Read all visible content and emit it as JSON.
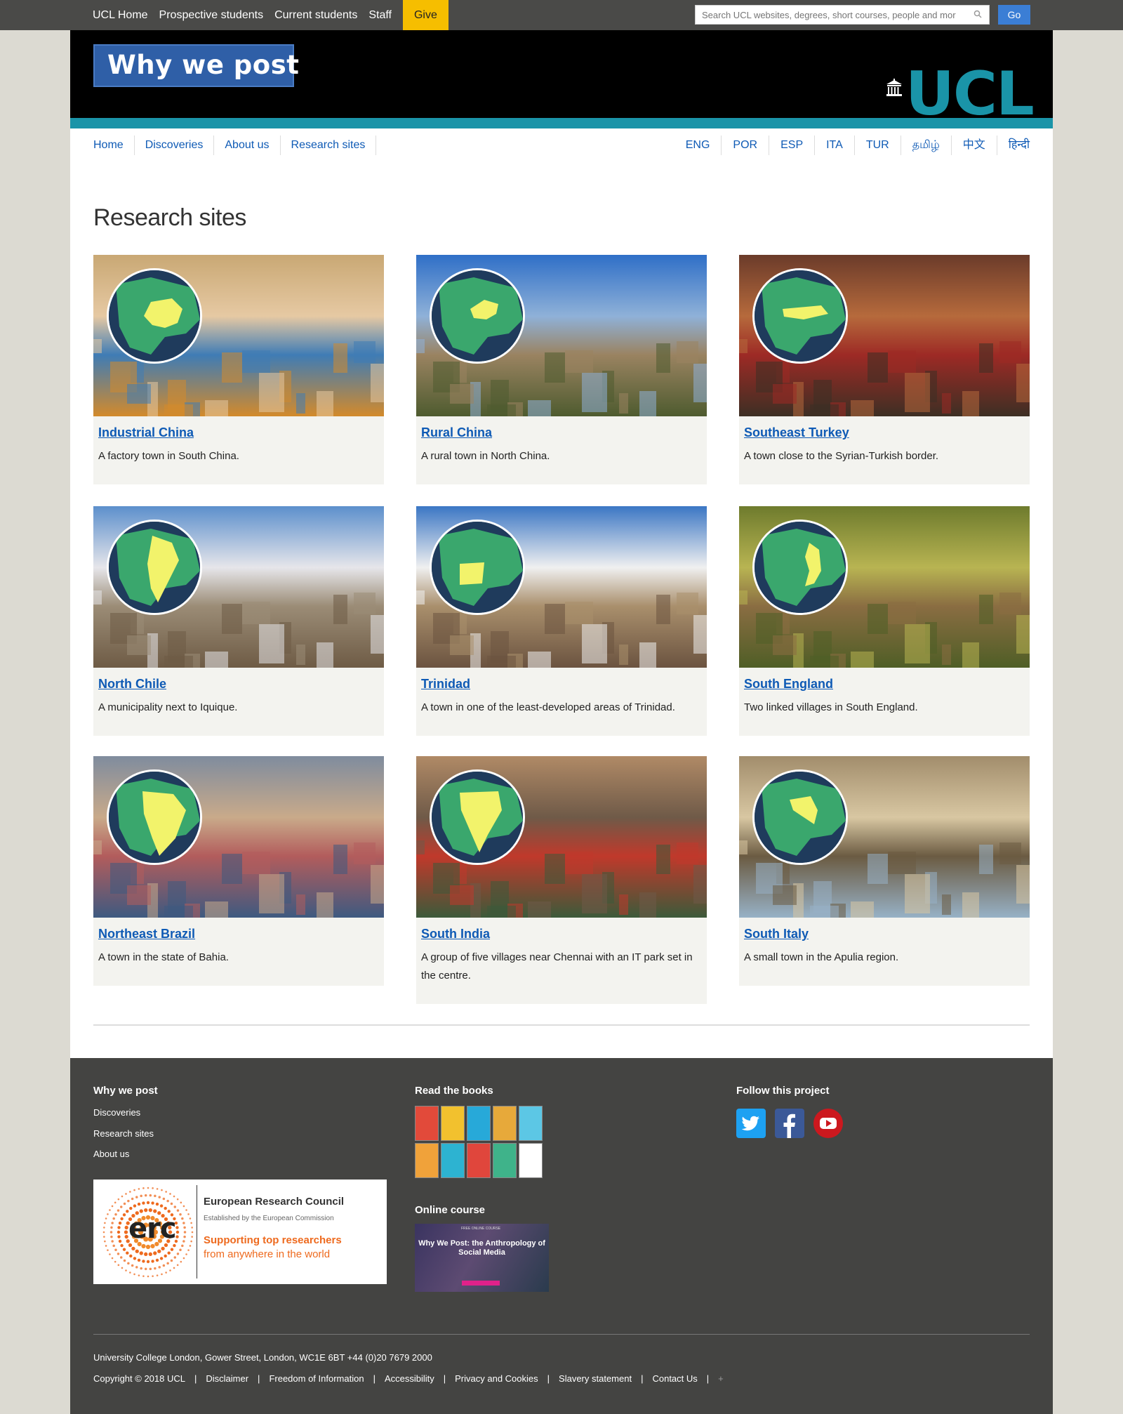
{
  "topbar": {
    "links": [
      "UCL Home",
      "Prospective students",
      "Current students",
      "Staff"
    ],
    "give_label": "Give",
    "search_placeholder": "Search UCL websites, degrees, short courses, people and more",
    "go_label": "Go"
  },
  "brand": {
    "site_logo": "Why we post",
    "institution_logo": "UCL"
  },
  "subnav": [
    "Home",
    "Discoveries",
    "About us",
    "Research sites"
  ],
  "languages": [
    "ENG",
    "POR",
    "ESP",
    "ITA",
    "TUR",
    "தமிழ்",
    "中文",
    "हिन्दी"
  ],
  "page_title": "Research sites",
  "sites": [
    {
      "title": "Industrial China",
      "desc": "A factory town in South China.",
      "photo_colors": [
        "#c9a874",
        "#e6c9a3",
        "#3f7cb5",
        "#d38a2b"
      ],
      "highlight_region": "china"
    },
    {
      "title": "Rural China",
      "desc": "A rural town in North China.",
      "photo_colors": [
        "#2f6fc7",
        "#8fb1d8",
        "#9a8361",
        "#4e5b2f"
      ],
      "highlight_region": "china-north"
    },
    {
      "title": "Southeast Turkey",
      "desc": "A town close to the Syrian-Turkish border.",
      "photo_colors": [
        "#6b3b2a",
        "#b66a3c",
        "#9d2a25",
        "#3d2f24"
      ],
      "highlight_region": "turkey"
    },
    {
      "title": "North Chile",
      "desc": "A municipality next to Iquique.",
      "photo_colors": [
        "#5c8fcc",
        "#e6e6ea",
        "#9b8c76",
        "#6e5b45"
      ],
      "highlight_region": "chile"
    },
    {
      "title": "Trinidad",
      "desc": "A town in one of the least-developed areas of Trinidad.",
      "photo_colors": [
        "#3b76c4",
        "#f0f0f0",
        "#a98f6c",
        "#6b5340"
      ],
      "highlight_region": "trinidad"
    },
    {
      "title": "South England",
      "desc": "Two linked villages in South England.",
      "photo_colors": [
        "#6e7b2d",
        "#b8b452",
        "#8a6d42",
        "#4f5e26"
      ],
      "highlight_region": "england"
    },
    {
      "title": "Northeast Brazil",
      "desc": "A town in the state of Bahia.",
      "photo_colors": [
        "#7f8c9e",
        "#c9aa8a",
        "#b25c5c",
        "#3e5a80"
      ],
      "highlight_region": "brazil"
    },
    {
      "title": "South India",
      "desc": "A group of five villages near Chennai with an IT park set in the centre.",
      "photo_colors": [
        "#b08a66",
        "#6f5a48",
        "#c0392b",
        "#3c5a3a"
      ],
      "highlight_region": "india"
    },
    {
      "title": "South Italy",
      "desc": "A small town in the Apulia region.",
      "photo_colors": [
        "#a28d6c",
        "#d8c7a2",
        "#6b5b42",
        "#97b1c6"
      ],
      "highlight_region": "italy"
    }
  ],
  "footer": {
    "col1_heading": "Why we post",
    "col1_links": [
      "Discoveries",
      "Research sites",
      "About us"
    ],
    "erc": {
      "name": "European Research Council",
      "sub": "Established by the European Commission",
      "tag_bold": "Supporting top researchers",
      "tag_rest": "from anywhere in the world",
      "logo_text": "erc"
    },
    "col2_heading": "Read the books",
    "book_colors": [
      "#e24a3a",
      "#f2c12e",
      "#27a9d9",
      "#e7a93a",
      "#5cc7e5",
      "#f0a23a",
      "#2db3d1",
      "#e0463c",
      "#3fb38a",
      "#ffffff"
    ],
    "course_heading": "Online course",
    "course_title": "Why We Post: the Anthropology of Social Media",
    "course_small": "FREE ONLINE COURSE",
    "col3_heading": "Follow this project",
    "social": [
      "twitter-icon",
      "facebook-icon",
      "youtube-icon"
    ],
    "address": "University College London, Gower Street, London, WC1E 6BT +44 (0)20 7679 2000",
    "legal": [
      "Copyright © 2018 UCL",
      "Disclaimer",
      "Freedom of Information",
      "Accessibility",
      "Privacy and Cookies",
      "Slavery statement",
      "Contact Us"
    ],
    "legal_end_icon": "+"
  }
}
